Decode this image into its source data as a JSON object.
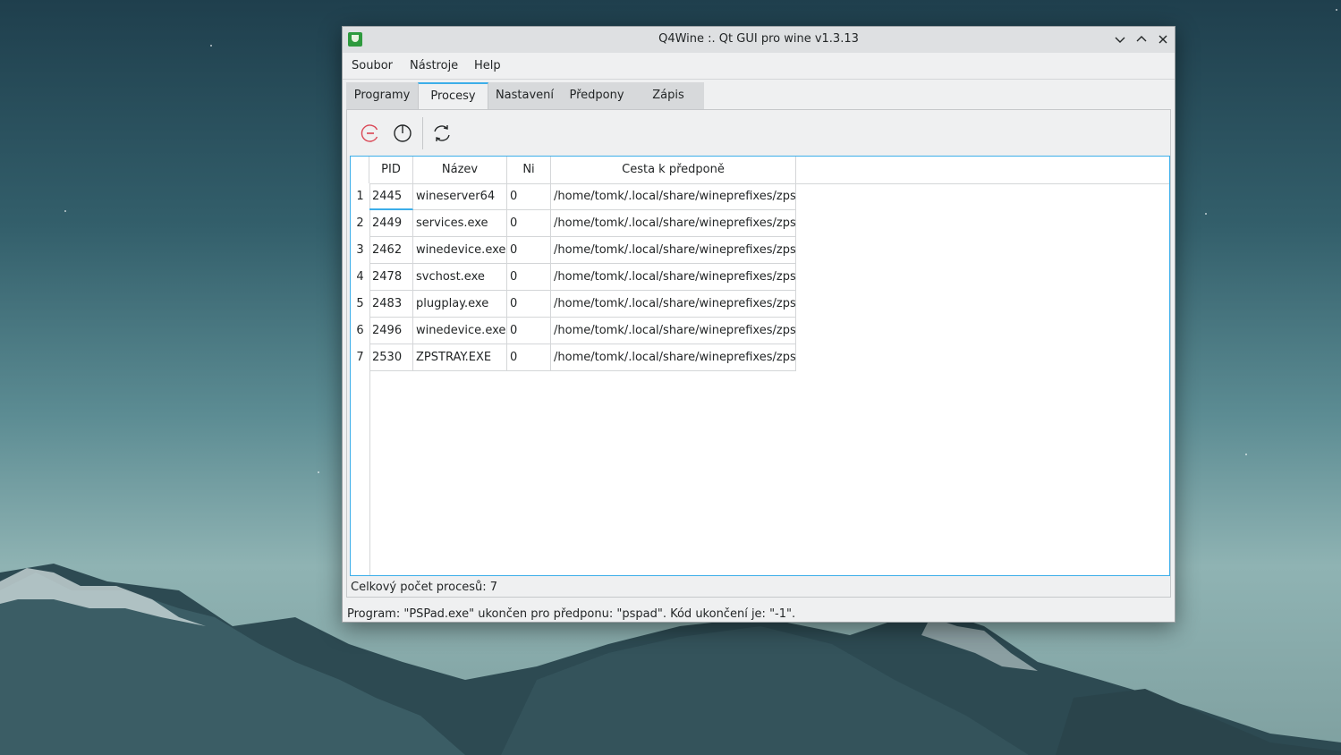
{
  "window": {
    "title": "Q4Wine :. Qt GUI pro wine v1.3.13"
  },
  "menu": {
    "items": [
      "Soubor",
      "Nástroje",
      "Help"
    ]
  },
  "tabs": [
    {
      "label": "Programy",
      "active": false
    },
    {
      "label": "Procesy",
      "active": true
    },
    {
      "label": "Nastavení",
      "active": false
    },
    {
      "label": "Předpony",
      "active": false
    },
    {
      "label": "Zápis",
      "active": false
    }
  ],
  "toolbar": {
    "buttons": [
      {
        "icon": "stop-process-icon",
        "color": "#da4453"
      },
      {
        "icon": "power-icon",
        "color": "#232627"
      },
      {
        "icon": "refresh-icon",
        "color": "#232627"
      }
    ]
  },
  "table": {
    "columns": [
      "PID",
      "Název",
      "Ni",
      "Cesta k předponě"
    ],
    "rows": [
      {
        "num": "1",
        "pid": "2445",
        "name": "wineserver64",
        "ni": "0",
        "path": "/home/tomk/.local/share/wineprefixes/zps"
      },
      {
        "num": "2",
        "pid": "2449",
        "name": "services.exe",
        "ni": "0",
        "path": "/home/tomk/.local/share/wineprefixes/zps"
      },
      {
        "num": "3",
        "pid": "2462",
        "name": "winedevice.exe",
        "ni": "0",
        "path": "/home/tomk/.local/share/wineprefixes/zps"
      },
      {
        "num": "4",
        "pid": "2478",
        "name": "svchost.exe",
        "ni": "0",
        "path": "/home/tomk/.local/share/wineprefixes/zps"
      },
      {
        "num": "5",
        "pid": "2483",
        "name": "plugplay.exe",
        "ni": "0",
        "path": "/home/tomk/.local/share/wineprefixes/zps"
      },
      {
        "num": "6",
        "pid": "2496",
        "name": "winedevice.exe",
        "ni": "0",
        "path": "/home/tomk/.local/share/wineprefixes/zps"
      },
      {
        "num": "7",
        "pid": "2530",
        "name": "ZPSTRAY.EXE",
        "ni": "0",
        "path": "/home/tomk/.local/share/wineprefixes/zps"
      }
    ]
  },
  "process_count": "Celkový počet procesů: 7",
  "statusbar": "Program: \"PSPad.exe\" ukončen pro předponu: \"pspad\". Kód ukončení je: \"-1\".",
  "colors": {
    "accent": "#3daee9",
    "stop": "#da4453",
    "app_icon": "#2e9a3e"
  }
}
